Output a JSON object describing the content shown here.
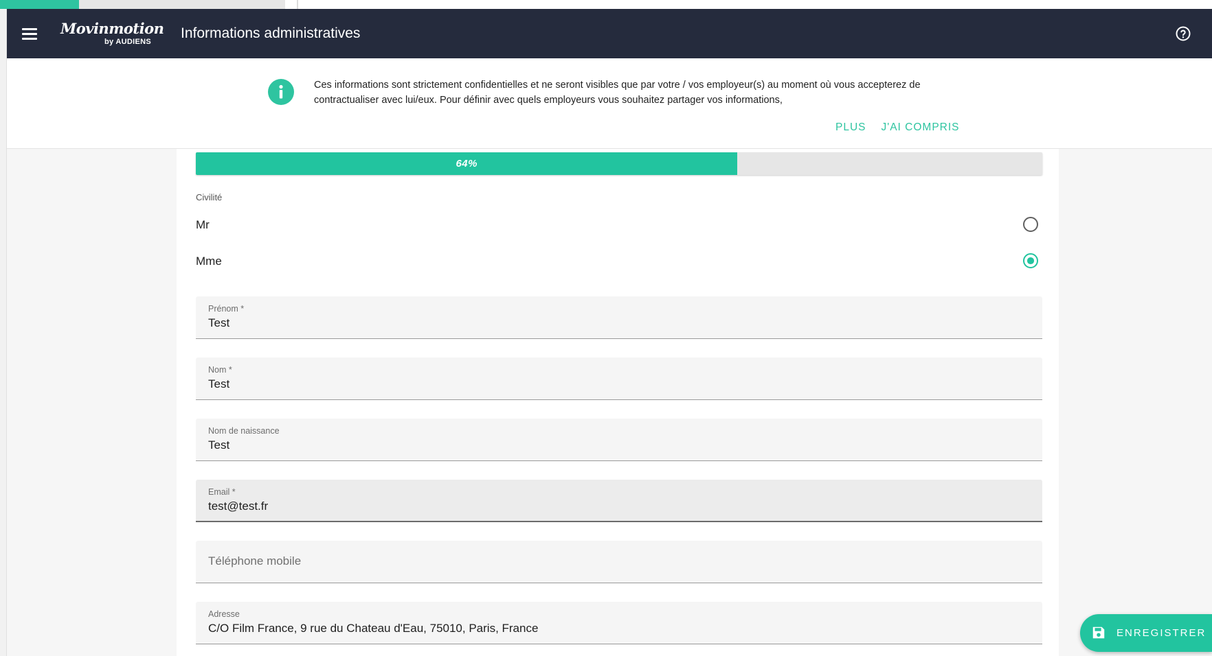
{
  "app": {
    "brand": "Movinmotion",
    "brand_sub": "by AUDIENS",
    "title": "Informations administratives"
  },
  "banner": {
    "text": "Ces informations sont strictement confidentielles et ne seront visibles que par votre / vos employeur(s) au moment où vous accepterez de contractualiser avec lui/eux. Pour définir avec quels employeurs vous souhaitez partager vos informations,",
    "more_label": "PLUS",
    "ok_label": "J'AI COMPRIS"
  },
  "progress": {
    "value": 0.64,
    "label": "64%"
  },
  "form": {
    "civility_label": "Civilité",
    "civility_options": [
      {
        "label": "Mr",
        "selected": false
      },
      {
        "label": "Mme",
        "selected": true
      }
    ],
    "fields": {
      "prenom": {
        "label": "Prénom *",
        "value": "Test"
      },
      "nom": {
        "label": "Nom *",
        "value": "Test"
      },
      "naissance": {
        "label": "Nom de naissance",
        "value": "Test"
      },
      "email": {
        "label": "Email *",
        "value": "test@test.fr"
      },
      "telephone": {
        "placeholder": "Téléphone mobile"
      },
      "adresse": {
        "label": "Adresse",
        "value": "C/O Film France, 9 rue du Chateau d'Eau, 75010, Paris, France"
      }
    }
  },
  "actions": {
    "save_label": "ENREGISTRER"
  },
  "colors": {
    "accent": "#22c49f",
    "appbar": "#252b3d"
  },
  "icons": {
    "menu": "hamburger-menu-icon",
    "help": "help-circle-icon",
    "info": "info-icon",
    "save": "floppy-disk-icon"
  }
}
